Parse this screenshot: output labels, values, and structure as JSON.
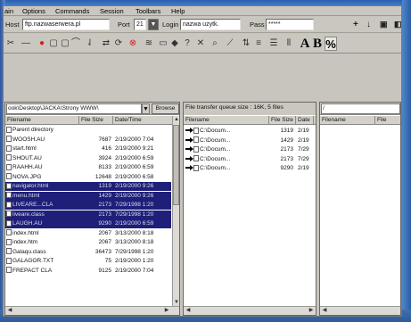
{
  "menu": [
    "ain",
    "Options",
    "Commands",
    "Session",
    "Toolbars",
    "Help"
  ],
  "connection": {
    "host_label": "Host",
    "host_value": "ftp.nazwaserwera.pl",
    "port_label": "Port",
    "port_value": "21",
    "login_label": "Login",
    "login_value": "nazwa uzytk.",
    "pass_label": "Pass",
    "pass_value": "*****"
  },
  "toolbar_text": {
    "bold": "A",
    "bold_b": "B"
  },
  "local": {
    "path": "ook\\Desktop\\JACKA\\Strony WWW\\",
    "browse_label": "Browse",
    "headers": {
      "name": "Filename",
      "size": "File Size",
      "date": "Date/Time"
    },
    "files": [
      {
        "name": "Parent directory",
        "size": "",
        "date": "",
        "selected": false
      },
      {
        "name": "WOOSH.AU",
        "size": "7687",
        "date": "2/19/2000 7:04",
        "selected": false
      },
      {
        "name": "start.html",
        "size": "416",
        "date": "2/19/2000 9:21",
        "selected": false
      },
      {
        "name": "SHOUT.AU",
        "size": "3924",
        "date": "2/19/2000 6:59",
        "selected": false
      },
      {
        "name": "RAAHH.AU",
        "size": "8133",
        "date": "2/19/2000 6:59",
        "selected": false
      },
      {
        "name": "NOVA.JPG",
        "size": "12648",
        "date": "2/19/2000 6:58",
        "selected": false
      },
      {
        "name": "navigator.html",
        "size": "1319",
        "date": "2/19/2000 9:26",
        "selected": true
      },
      {
        "name": "menu.html",
        "size": "1429",
        "date": "2/19/2000 9:26",
        "selected": true
      },
      {
        "name": "LIVEARE...CLA",
        "size": "2173",
        "date": "7/29/1998 1:20",
        "selected": true
      },
      {
        "name": "liveare.class",
        "size": "2173",
        "date": "7/29/1998 1:20",
        "selected": true
      },
      {
        "name": "LAUGH.AU",
        "size": "9290",
        "date": "2/19/2000 6:59",
        "selected": true
      },
      {
        "name": "index.html",
        "size": "2067",
        "date": "3/13/2000 8:18",
        "selected": false
      },
      {
        "name": "index.htm",
        "size": "2067",
        "date": "3/13/2000 8:18",
        "selected": false
      },
      {
        "name": "Galaqu.class",
        "size": "36473",
        "date": "7/29/1998 1:20",
        "selected": false
      },
      {
        "name": "GALAGOR.TXT",
        "size": "75",
        "date": "2/19/2000 1:20",
        "selected": false
      },
      {
        "name": "FREPACT CLA",
        "size": "9125",
        "date": "2/19/2000 7:04",
        "selected": false
      }
    ]
  },
  "queue": {
    "title": "File transfer queue size : 16K, 5 files",
    "headers": {
      "name": "Filename",
      "size": "File Size",
      "date": "Date"
    },
    "items": [
      {
        "name": "C:\\Docum...",
        "size": "1319",
        "date": "2/19"
      },
      {
        "name": "C:\\Docum...",
        "size": "1429",
        "date": "2/19"
      },
      {
        "name": "C:\\Docum...",
        "size": "2173",
        "date": "7/29"
      },
      {
        "name": "C:\\Docum...",
        "size": "2173",
        "date": "7/29"
      },
      {
        "name": "C:\\Docum...",
        "size": "9290",
        "date": "2/19"
      }
    ]
  },
  "remote": {
    "path": "/",
    "headers": {
      "name": "Filename",
      "size": "File"
    }
  }
}
